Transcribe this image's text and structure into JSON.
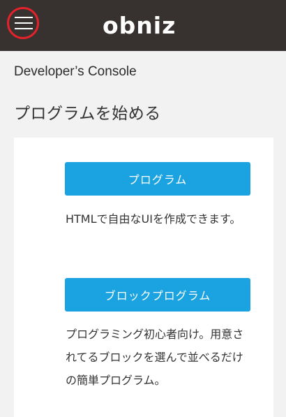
{
  "header": {
    "menu_icon": "hamburger-menu-icon",
    "logo_text": "obniz",
    "highlight_color": "#e3222b"
  },
  "console": {
    "title": "Developer’s Console"
  },
  "section": {
    "title": "プログラムを始める"
  },
  "options": [
    {
      "button_label": "プログラム",
      "description": "HTMLで自由なUIを作成できます。"
    },
    {
      "button_label": "ブロックプログラム",
      "description": "プログラミング初心者向け。用意されてるブロックを選んで並べるだけの簡単プログラム。"
    }
  ],
  "colors": {
    "header_bg": "#373230",
    "button_bg": "#1aa3e0",
    "page_bg": "#f2f2f2"
  }
}
